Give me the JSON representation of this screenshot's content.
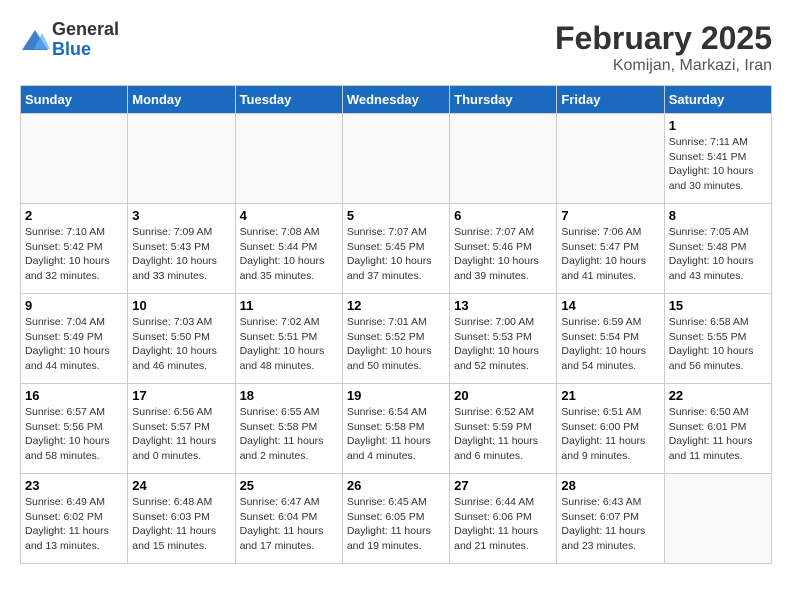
{
  "logo": {
    "general": "General",
    "blue": "Blue"
  },
  "title": "February 2025",
  "subtitle": "Komijan, Markazi, Iran",
  "headers": [
    "Sunday",
    "Monday",
    "Tuesday",
    "Wednesday",
    "Thursday",
    "Friday",
    "Saturday"
  ],
  "weeks": [
    [
      {
        "day": "",
        "info": ""
      },
      {
        "day": "",
        "info": ""
      },
      {
        "day": "",
        "info": ""
      },
      {
        "day": "",
        "info": ""
      },
      {
        "day": "",
        "info": ""
      },
      {
        "day": "",
        "info": ""
      },
      {
        "day": "1",
        "info": "Sunrise: 7:11 AM\nSunset: 5:41 PM\nDaylight: 10 hours\nand 30 minutes."
      }
    ],
    [
      {
        "day": "2",
        "info": "Sunrise: 7:10 AM\nSunset: 5:42 PM\nDaylight: 10 hours\nand 32 minutes."
      },
      {
        "day": "3",
        "info": "Sunrise: 7:09 AM\nSunset: 5:43 PM\nDaylight: 10 hours\nand 33 minutes."
      },
      {
        "day": "4",
        "info": "Sunrise: 7:08 AM\nSunset: 5:44 PM\nDaylight: 10 hours\nand 35 minutes."
      },
      {
        "day": "5",
        "info": "Sunrise: 7:07 AM\nSunset: 5:45 PM\nDaylight: 10 hours\nand 37 minutes."
      },
      {
        "day": "6",
        "info": "Sunrise: 7:07 AM\nSunset: 5:46 PM\nDaylight: 10 hours\nand 39 minutes."
      },
      {
        "day": "7",
        "info": "Sunrise: 7:06 AM\nSunset: 5:47 PM\nDaylight: 10 hours\nand 41 minutes."
      },
      {
        "day": "8",
        "info": "Sunrise: 7:05 AM\nSunset: 5:48 PM\nDaylight: 10 hours\nand 43 minutes."
      }
    ],
    [
      {
        "day": "9",
        "info": "Sunrise: 7:04 AM\nSunset: 5:49 PM\nDaylight: 10 hours\nand 44 minutes."
      },
      {
        "day": "10",
        "info": "Sunrise: 7:03 AM\nSunset: 5:50 PM\nDaylight: 10 hours\nand 46 minutes."
      },
      {
        "day": "11",
        "info": "Sunrise: 7:02 AM\nSunset: 5:51 PM\nDaylight: 10 hours\nand 48 minutes."
      },
      {
        "day": "12",
        "info": "Sunrise: 7:01 AM\nSunset: 5:52 PM\nDaylight: 10 hours\nand 50 minutes."
      },
      {
        "day": "13",
        "info": "Sunrise: 7:00 AM\nSunset: 5:53 PM\nDaylight: 10 hours\nand 52 minutes."
      },
      {
        "day": "14",
        "info": "Sunrise: 6:59 AM\nSunset: 5:54 PM\nDaylight: 10 hours\nand 54 minutes."
      },
      {
        "day": "15",
        "info": "Sunrise: 6:58 AM\nSunset: 5:55 PM\nDaylight: 10 hours\nand 56 minutes."
      }
    ],
    [
      {
        "day": "16",
        "info": "Sunrise: 6:57 AM\nSunset: 5:56 PM\nDaylight: 10 hours\nand 58 minutes."
      },
      {
        "day": "17",
        "info": "Sunrise: 6:56 AM\nSunset: 5:57 PM\nDaylight: 11 hours\nand 0 minutes."
      },
      {
        "day": "18",
        "info": "Sunrise: 6:55 AM\nSunset: 5:58 PM\nDaylight: 11 hours\nand 2 minutes."
      },
      {
        "day": "19",
        "info": "Sunrise: 6:54 AM\nSunset: 5:58 PM\nDaylight: 11 hours\nand 4 minutes."
      },
      {
        "day": "20",
        "info": "Sunrise: 6:52 AM\nSunset: 5:59 PM\nDaylight: 11 hours\nand 6 minutes."
      },
      {
        "day": "21",
        "info": "Sunrise: 6:51 AM\nSunset: 6:00 PM\nDaylight: 11 hours\nand 9 minutes."
      },
      {
        "day": "22",
        "info": "Sunrise: 6:50 AM\nSunset: 6:01 PM\nDaylight: 11 hours\nand 11 minutes."
      }
    ],
    [
      {
        "day": "23",
        "info": "Sunrise: 6:49 AM\nSunset: 6:02 PM\nDaylight: 11 hours\nand 13 minutes."
      },
      {
        "day": "24",
        "info": "Sunrise: 6:48 AM\nSunset: 6:03 PM\nDaylight: 11 hours\nand 15 minutes."
      },
      {
        "day": "25",
        "info": "Sunrise: 6:47 AM\nSunset: 6:04 PM\nDaylight: 11 hours\nand 17 minutes."
      },
      {
        "day": "26",
        "info": "Sunrise: 6:45 AM\nSunset: 6:05 PM\nDaylight: 11 hours\nand 19 minutes."
      },
      {
        "day": "27",
        "info": "Sunrise: 6:44 AM\nSunset: 6:06 PM\nDaylight: 11 hours\nand 21 minutes."
      },
      {
        "day": "28",
        "info": "Sunrise: 6:43 AM\nSunset: 6:07 PM\nDaylight: 11 hours\nand 23 minutes."
      },
      {
        "day": "",
        "info": ""
      }
    ]
  ]
}
